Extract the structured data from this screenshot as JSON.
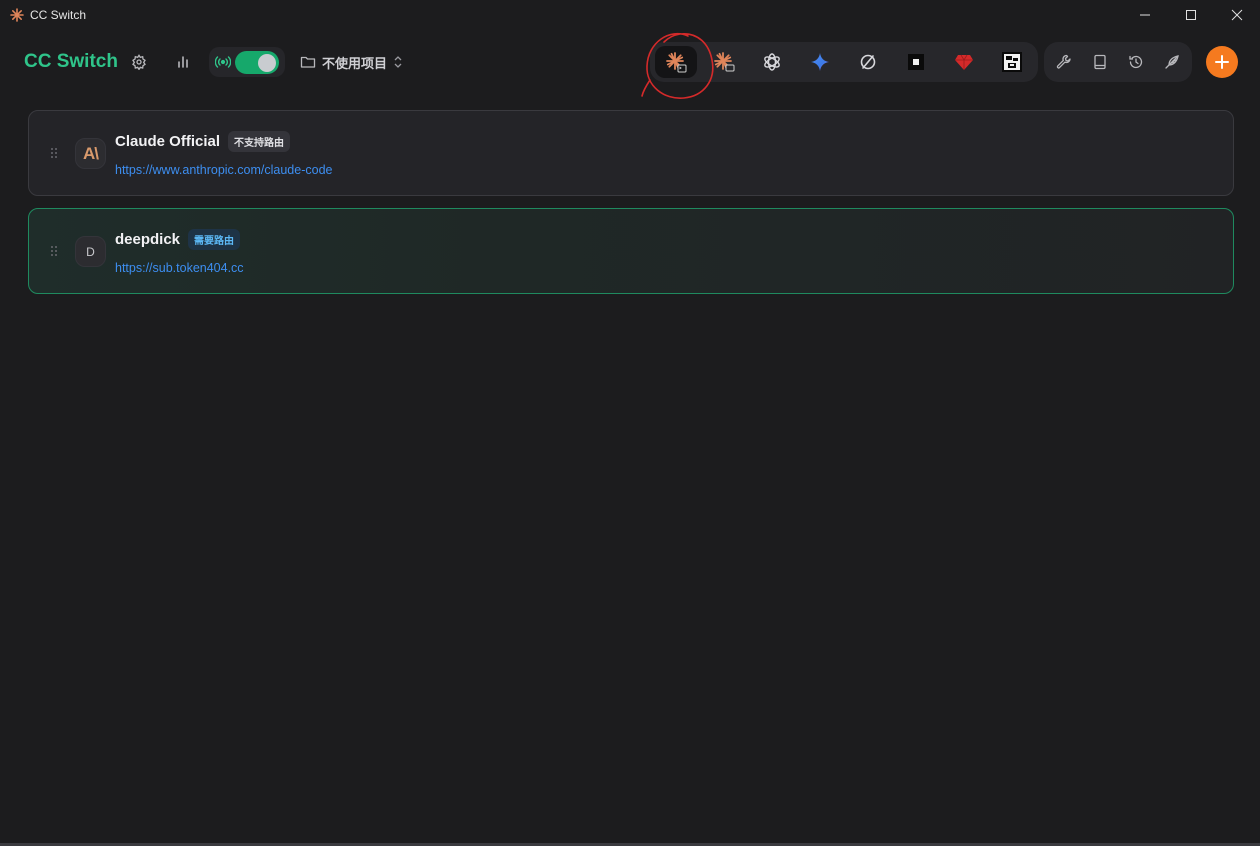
{
  "window": {
    "title": "CC Switch",
    "controls": {
      "minimize": "—",
      "maximize": "☐",
      "close": "✕"
    }
  },
  "header": {
    "brand": "CC Switch",
    "settings_icon": "gear-icon",
    "stats_icon": "bar-chart-icon",
    "proxy": {
      "icon": "radio-tower-icon",
      "enabled": true,
      "accent": "#16a86b"
    },
    "project_selector": {
      "label": "不使用项目",
      "icon": "folder-icon"
    }
  },
  "apps": [
    {
      "id": "claude-code",
      "icon": "claude-terminal-icon",
      "active": true
    },
    {
      "id": "claude-desktop",
      "icon": "claude-desktop-icon",
      "active": false
    },
    {
      "id": "codex",
      "icon": "openai-icon",
      "active": false
    },
    {
      "id": "gemini",
      "icon": "gemini-icon",
      "active": false
    },
    {
      "id": "app-5",
      "icon": "sync-circle-icon",
      "active": false
    },
    {
      "id": "app-6",
      "icon": "black-square-icon",
      "active": false
    },
    {
      "id": "app-7",
      "icon": "red-gem-icon",
      "active": false
    },
    {
      "id": "app-8",
      "icon": "pixel-face-icon",
      "active": false
    }
  ],
  "tools": [
    {
      "id": "tools",
      "icon": "wrench-icon"
    },
    {
      "id": "prompts",
      "icon": "book-icon"
    },
    {
      "id": "history",
      "icon": "history-icon"
    },
    {
      "id": "skills",
      "icon": "feather-icon"
    }
  ],
  "add_button": {
    "icon": "plus-icon",
    "color": "#f57a1f"
  },
  "providers": [
    {
      "name": "Claude Official",
      "avatar": "A\\",
      "badge": "不支持路由",
      "url": "https://www.anthropic.com/claude-code",
      "active": false
    },
    {
      "name": "deepdick",
      "avatar": "D",
      "badge": "需要路由",
      "url": "https://sub.token404.cc",
      "active": true
    }
  ],
  "colors": {
    "background": "#1c1c1e",
    "brand": "#2fc48a",
    "link": "#3d8ef0",
    "active_border": "#1f8a5f",
    "annotation": "#d42a2a"
  }
}
